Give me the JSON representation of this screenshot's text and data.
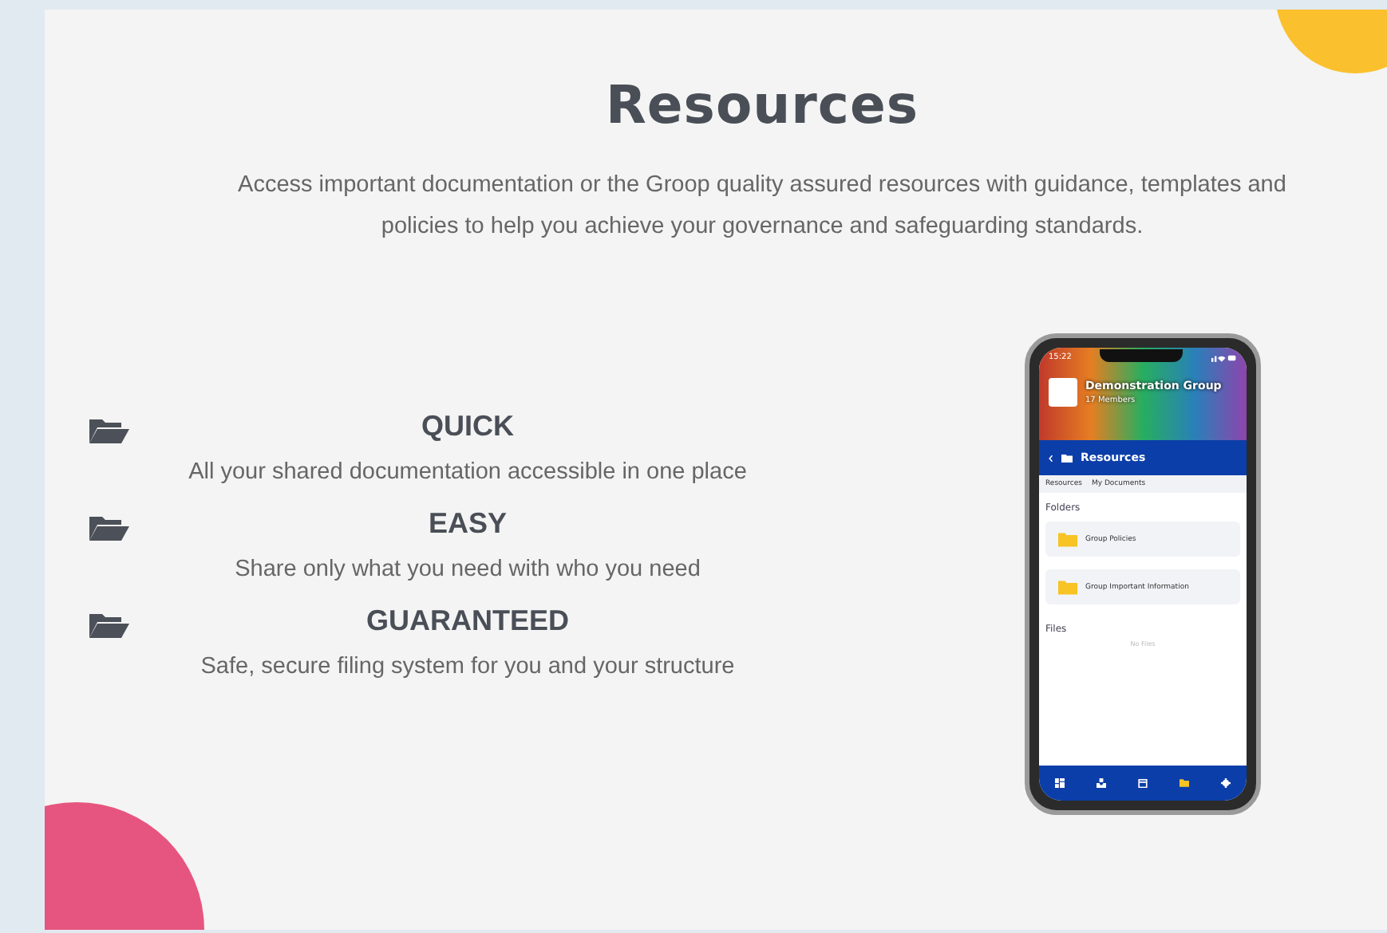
{
  "title": "Resources",
  "description": "Access important documentation or the Groop quality assured resources with guidance, templates and policies to help you achieve your governance and safeguarding standards.",
  "features": [
    {
      "heading": "QUICK",
      "text": "All your shared documentation accessible in one place"
    },
    {
      "heading": "EASY",
      "text": "Share only what you need with who you need"
    },
    {
      "heading": "GUARANTEED",
      "text": "Safe, secure filing system for you and your structure"
    }
  ],
  "phone": {
    "time": "15:22",
    "group_name": "Demonstration Group",
    "members": "17 Members",
    "screen_title": "Resources",
    "breadcrumb": [
      "Resources",
      "My Documents"
    ],
    "folders_label": "Folders",
    "folders": [
      "Group Policies",
      "Group Important Information"
    ],
    "files_label": "Files",
    "files_empty": "No Files",
    "nav": [
      {
        "kind": "dashboard",
        "selected": false
      },
      {
        "kind": "inbox",
        "selected": false
      },
      {
        "kind": "calendar",
        "selected": false
      },
      {
        "kind": "folder",
        "selected": true
      },
      {
        "kind": "settings",
        "selected": false
      }
    ]
  }
}
